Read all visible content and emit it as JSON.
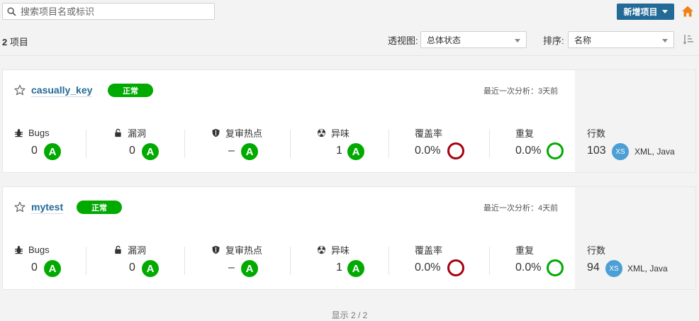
{
  "search": {
    "placeholder": "搜索项目名或标识"
  },
  "toolbar": {
    "new_project_label": "新增项目"
  },
  "colors": {
    "accent": "#236a97",
    "status_ok": "#00aa00",
    "coverage_bad": "#a4030f",
    "duplication_good": "#00aa00",
    "language_badge": "#4b9fd5"
  },
  "summary": {
    "count": "2",
    "label": "项目"
  },
  "filters": {
    "perspective_label": "透视图:",
    "perspective_value": "总体状态",
    "sort_label": "排序:",
    "sort_value": "名称"
  },
  "metric_labels": {
    "bugs": "Bugs",
    "vulnerabilities": "漏洞",
    "hotspots": "复审热点",
    "smells": "异味",
    "coverage": "覆盖率",
    "duplications": "重复",
    "lines": "行数"
  },
  "projects": [
    {
      "name": "casually_key",
      "status": "正常",
      "last_analysis": "最近一次分析：3天前",
      "bugs": "0",
      "bugs_rating": "A",
      "vulnerabilities": "0",
      "vulnerabilities_rating": "A",
      "hotspots": "–",
      "hotspots_rating": "A",
      "smells": "1",
      "smells_rating": "A",
      "coverage": "0.0%",
      "duplications": "0.0%",
      "lines": "103",
      "size_badge": "XS",
      "languages": "XML, Java"
    },
    {
      "name": "mytest",
      "status": "正常",
      "last_analysis": "最近一次分析：4天前",
      "bugs": "0",
      "bugs_rating": "A",
      "vulnerabilities": "0",
      "vulnerabilities_rating": "A",
      "hotspots": "–",
      "hotspots_rating": "A",
      "smells": "1",
      "smells_rating": "A",
      "coverage": "0.0%",
      "duplications": "0.0%",
      "lines": "94",
      "size_badge": "XS",
      "languages": "XML, Java"
    }
  ],
  "footer": {
    "shown": "显示 2 / 2"
  }
}
